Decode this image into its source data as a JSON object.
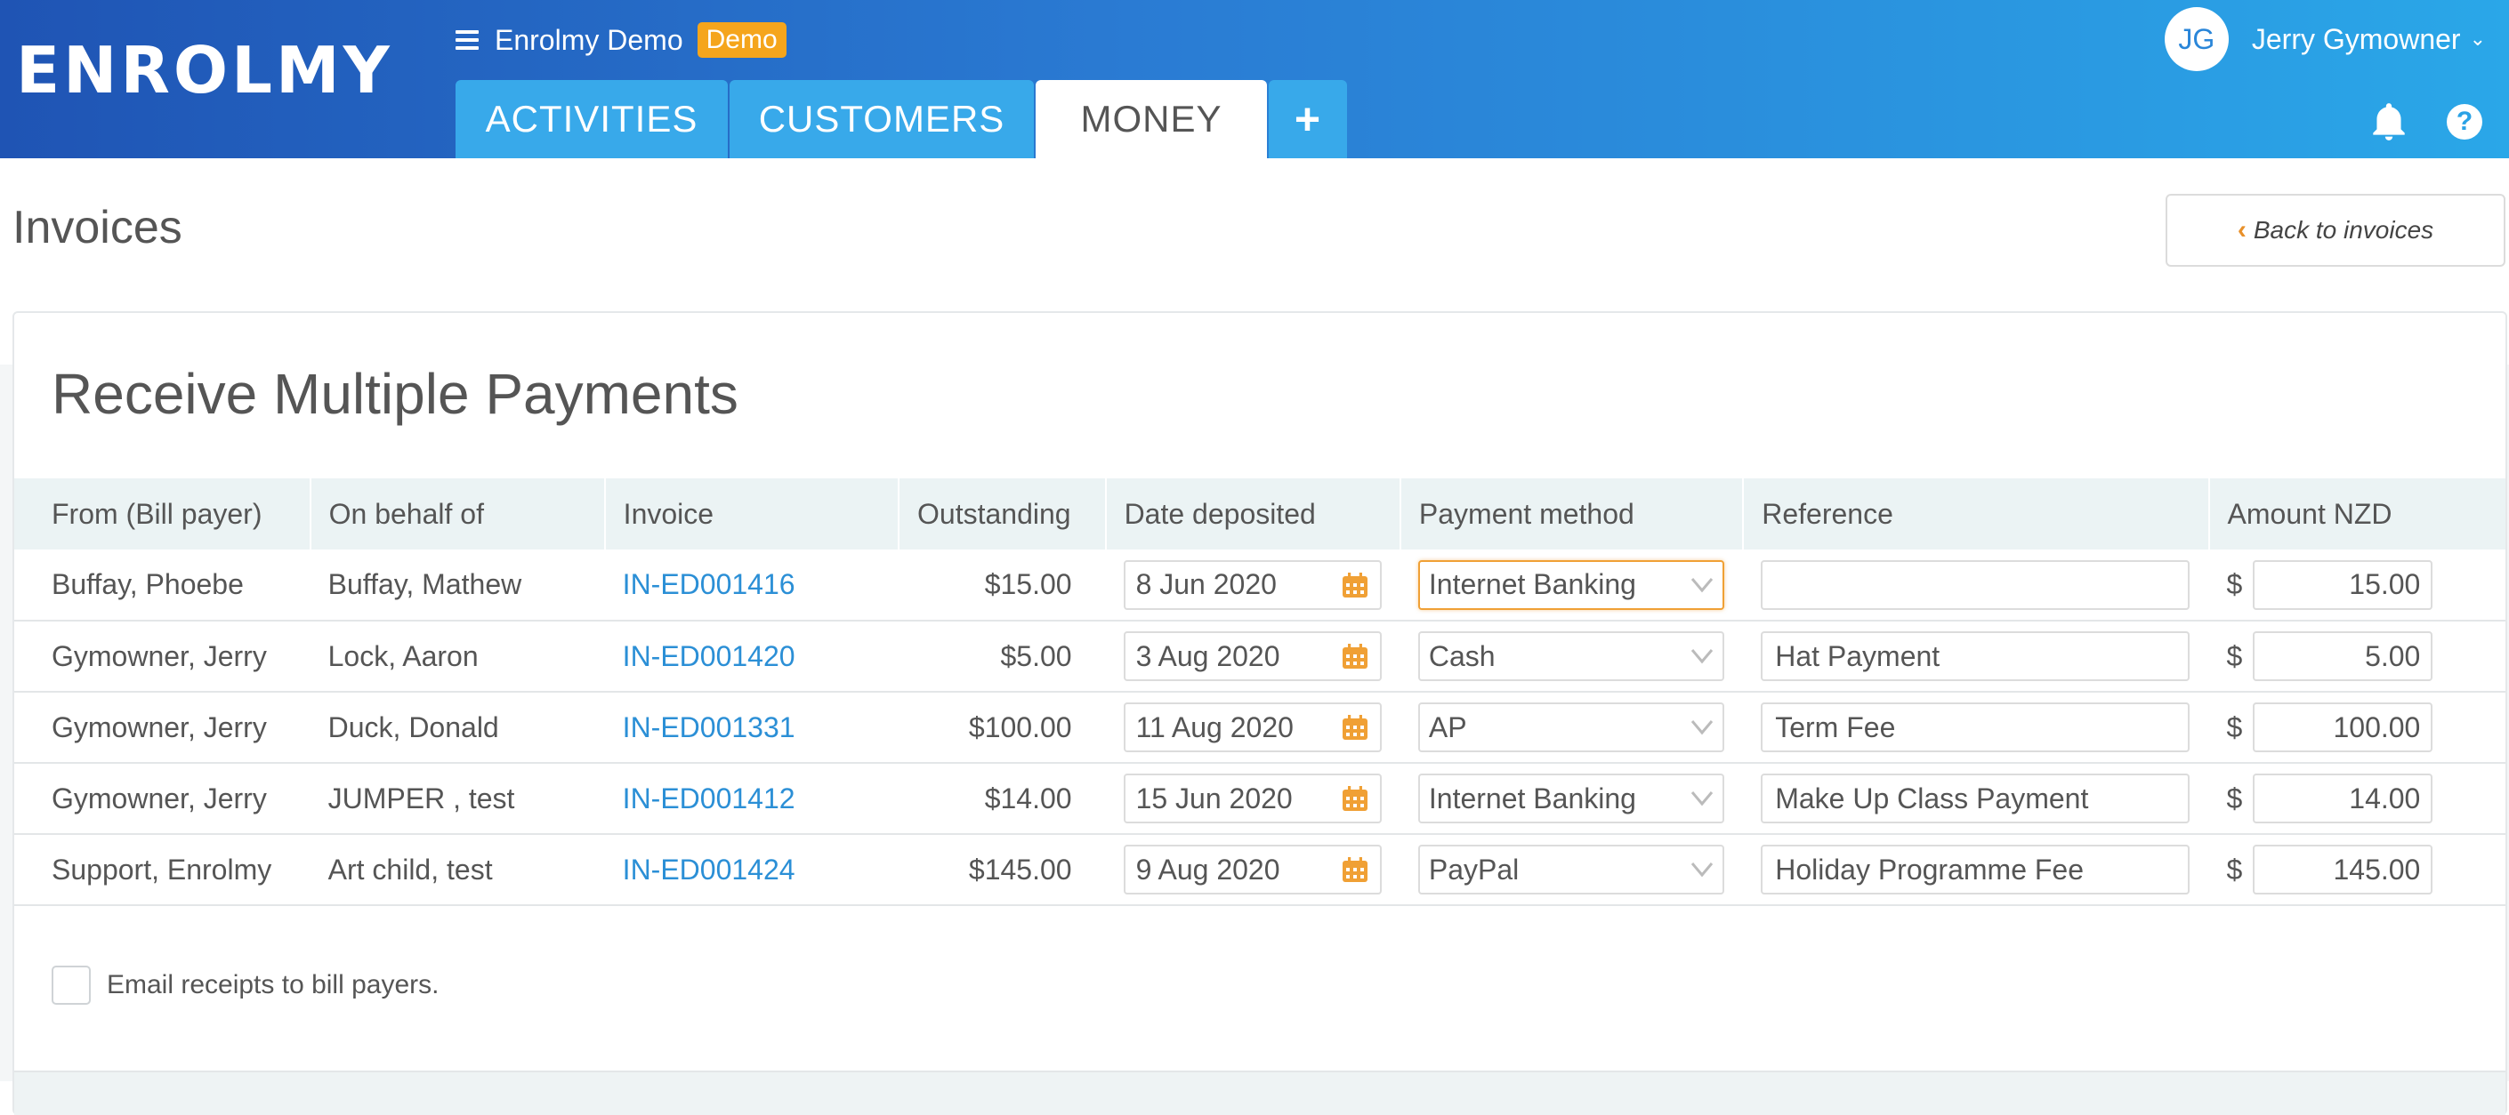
{
  "header": {
    "logo_text": "ENROLMY",
    "org_name": "Enrolmy Demo",
    "org_badge": "Demo",
    "tabs": [
      {
        "label": "ACTIVITIES"
      },
      {
        "label": "CUSTOMERS"
      },
      {
        "label": "MONEY",
        "active": true
      },
      {
        "label": "+"
      }
    ],
    "user": {
      "initials": "JG",
      "name": "Jerry Gymowner"
    },
    "icons": [
      "hamburger-icon",
      "bell-icon",
      "help-icon",
      "chevron-down-icon"
    ]
  },
  "page": {
    "title": "Invoices",
    "back_button": "Back to invoices"
  },
  "card": {
    "title": "Receive Multiple Payments",
    "columns": [
      "From (Bill payer)",
      "On behalf of",
      "Invoice",
      "Outstanding",
      "Date deposited",
      "Payment method",
      "Reference",
      "Amount NZD"
    ],
    "rows": [
      {
        "from": "Buffay, Phoebe",
        "behalf": "Buffay, Mathew",
        "invoice": "IN-ED001416",
        "outstanding": "$15.00",
        "date": "8 Jun 2020",
        "method": "Internet Banking",
        "reference": "",
        "currency": "$",
        "amount": "15.00"
      },
      {
        "from": "Gymowner, Jerry",
        "behalf": "Lock, Aaron",
        "invoice": "IN-ED001420",
        "outstanding": "$5.00",
        "date": "3 Aug 2020",
        "method": "Cash",
        "reference": "Hat Payment",
        "currency": "$",
        "amount": "5.00"
      },
      {
        "from": "Gymowner, Jerry",
        "behalf": "Duck, Donald",
        "invoice": "IN-ED001331",
        "outstanding": "$100.00",
        "date": "11 Aug 2020",
        "method": "AP",
        "reference": "Term Fee",
        "currency": "$",
        "amount": "100.00"
      },
      {
        "from": "Gymowner, Jerry",
        "behalf": "JUMPER , test",
        "invoice": "IN-ED001412",
        "outstanding": "$14.00",
        "date": "15 Jun 2020",
        "method": "Internet Banking",
        "reference": "Make Up Class Payment",
        "currency": "$",
        "amount": "14.00"
      },
      {
        "from": "Support, Enrolmy",
        "behalf": "Art child, test",
        "invoice": "IN-ED001424",
        "outstanding": "$145.00",
        "date": "9 Aug 2020",
        "method": "PayPal",
        "reference": "Holiday Programme Fee",
        "currency": "$",
        "amount": "145.00"
      }
    ],
    "email_receipts_label": "Email receipts to bill payers.",
    "email_receipts_checked": false
  },
  "colors": {
    "header_start": "#1f54b4",
    "header_end": "#2aa7e8",
    "badge": "#f5a51c",
    "link": "#2b8fd6",
    "accent_orange": "#e8902a",
    "table_header_bg": "#ebf3f4"
  }
}
